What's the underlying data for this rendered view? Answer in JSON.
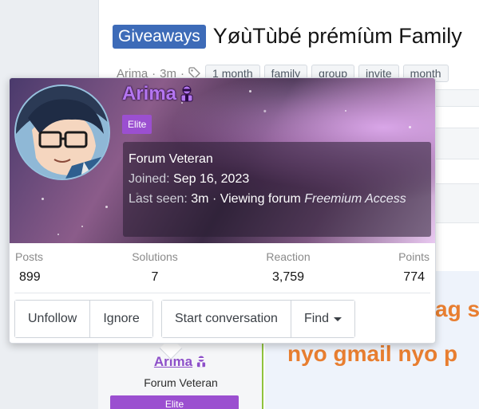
{
  "thread": {
    "prefix": "Giveaways",
    "title": "YøùTùbé prémíùm Family",
    "author": "Arima",
    "age": "3m",
    "tags": [
      "1 month",
      "family",
      "group",
      "invite",
      "month"
    ]
  },
  "post": {
    "poster_name": "Arima",
    "poster_title": "Forum Veteran",
    "poster_badge": "Elite",
    "body_line1": "ag s",
    "body_line2": "nyo gmail nyo p"
  },
  "card": {
    "username": "Arima",
    "badge": "Elite",
    "user_title": "Forum Veteran",
    "joined_label": "Joined:",
    "joined_value": "Sep 16, 2023",
    "last_seen_label": "Last seen:",
    "last_seen_value": "3m · Viewing forum",
    "last_seen_forum": "Freemium Access",
    "stats": [
      {
        "label": "Posts",
        "value": "899"
      },
      {
        "label": "Solutions",
        "value": "7"
      },
      {
        "label": "Reaction",
        "value": "3,759"
      },
      {
        "label": "Points",
        "value": "774"
      }
    ],
    "buttons": {
      "unfollow": "Unfollow",
      "ignore": "Ignore",
      "start_conversation": "Start conversation",
      "find": "Find"
    }
  },
  "colors": {
    "prefix_bg": "#3d6bb8",
    "username": "#b476f0",
    "badge_bg": "#9b4fd0",
    "orange_text": "#e87e30",
    "post_accent": "#8fc33d"
  },
  "icons": [
    "tag-icon",
    "ninja-icon",
    "caret-down-icon"
  ]
}
